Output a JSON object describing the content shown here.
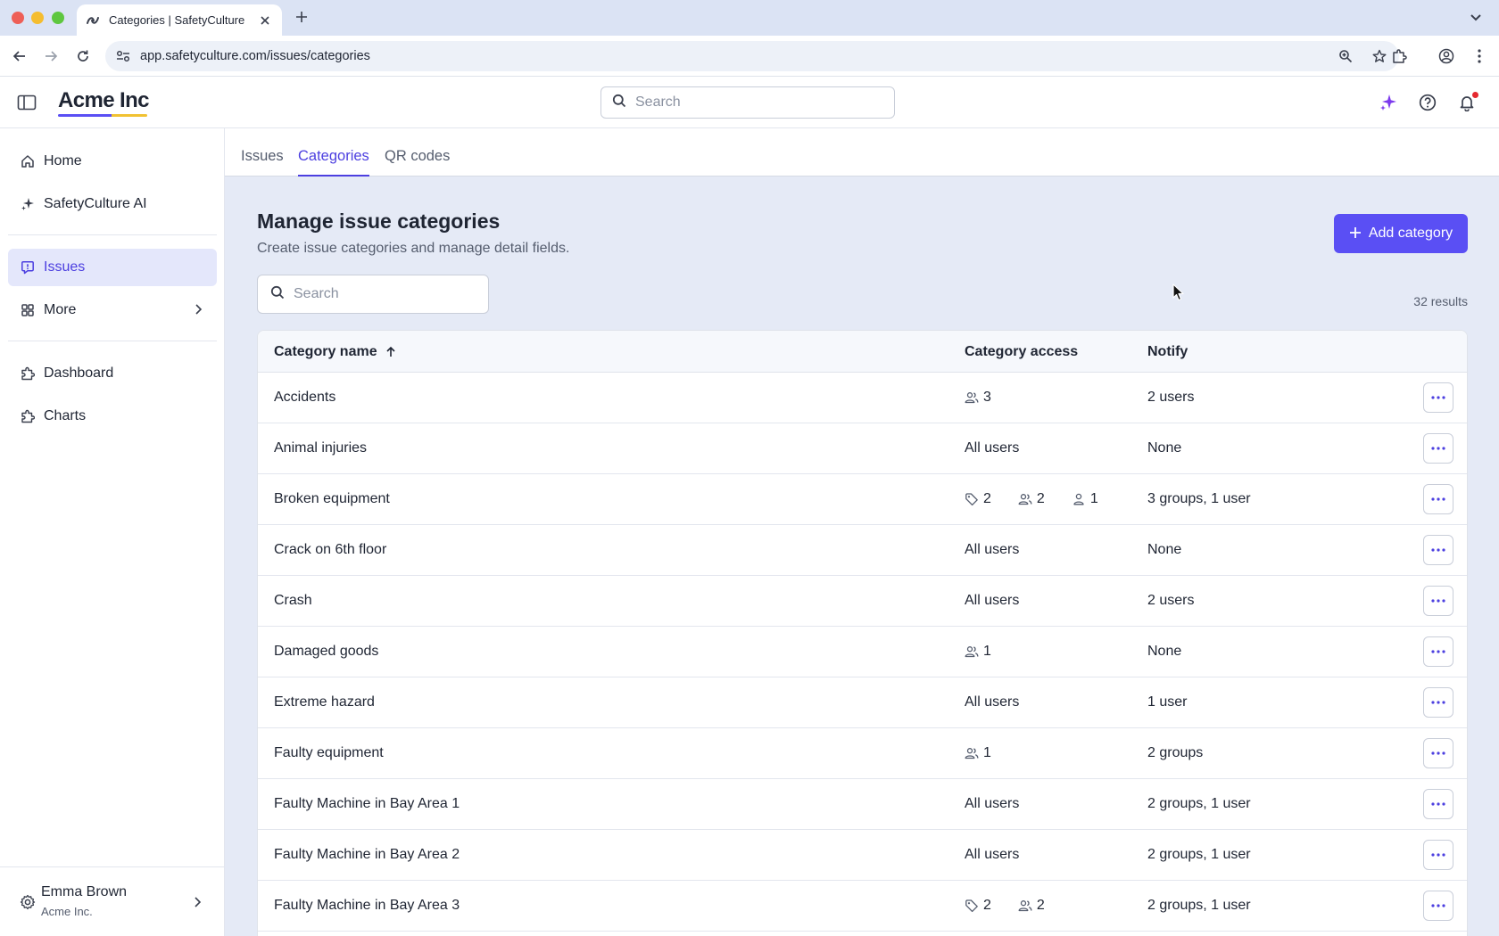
{
  "browser": {
    "tab_title": "Categories | SafetyCulture",
    "url": "app.safetyculture.com/issues/categories"
  },
  "header": {
    "brand": "Acme Inc",
    "search_placeholder": "Search"
  },
  "sidebar": {
    "items": [
      {
        "label": "Home",
        "icon": "home-icon"
      },
      {
        "label": "SafetyCulture AI",
        "icon": "sparkle-icon"
      },
      {
        "label": "Issues",
        "icon": "issue-icon",
        "active": true
      },
      {
        "label": "More",
        "icon": "grid-icon"
      },
      {
        "label": "Dashboard",
        "icon": "puzzle-icon"
      },
      {
        "label": "Charts",
        "icon": "puzzle-icon"
      }
    ],
    "user": {
      "name": "Emma Brown",
      "org": "Acme Inc."
    }
  },
  "tabs": [
    {
      "label": "Issues"
    },
    {
      "label": "Categories",
      "active": true
    },
    {
      "label": "QR codes"
    }
  ],
  "main": {
    "title": "Manage issue categories",
    "subtitle": "Create issue categories and manage detail fields.",
    "add_button": "Add category",
    "search_placeholder": "Search",
    "result_count": "32 results"
  },
  "table": {
    "columns": [
      "Category name",
      "Category access",
      "Notify"
    ],
    "rows": [
      {
        "name": "Accidents",
        "access_text": "",
        "access": [
          {
            "icon": "group-icon",
            "count": "3"
          }
        ],
        "notify": "2 users"
      },
      {
        "name": "Animal injuries",
        "access_text": "All users",
        "access": [],
        "notify": "None"
      },
      {
        "name": "Broken equipment",
        "access_text": "",
        "access": [
          {
            "icon": "tag-icon",
            "count": "2"
          },
          {
            "icon": "group-icon",
            "count": "2"
          },
          {
            "icon": "user-icon",
            "count": "1"
          }
        ],
        "notify": "3 groups, 1 user"
      },
      {
        "name": "Crack on 6th floor",
        "access_text": "All users",
        "access": [],
        "notify": "None"
      },
      {
        "name": "Crash",
        "access_text": "All users",
        "access": [],
        "notify": "2 users"
      },
      {
        "name": "Damaged goods",
        "access_text": "",
        "access": [
          {
            "icon": "group-icon",
            "count": "1"
          }
        ],
        "notify": "None"
      },
      {
        "name": "Extreme hazard",
        "access_text": "All users",
        "access": [],
        "notify": "1 user"
      },
      {
        "name": "Faulty equipment",
        "access_text": "",
        "access": [
          {
            "icon": "group-icon",
            "count": "1"
          }
        ],
        "notify": "2 groups"
      },
      {
        "name": "Faulty Machine in Bay Area 1",
        "access_text": "All users",
        "access": [],
        "notify": "2 groups, 1 user"
      },
      {
        "name": "Faulty Machine in Bay Area 2",
        "access_text": "All users",
        "access": [],
        "notify": "2 groups, 1 user"
      },
      {
        "name": "Faulty Machine in Bay Area 3",
        "access_text": "",
        "access": [
          {
            "icon": "tag-icon",
            "count": "2"
          },
          {
            "icon": "group-icon",
            "count": "2"
          }
        ],
        "notify": "2 groups, 1 user"
      }
    ]
  },
  "colors": {
    "accent": "#5a4ff4",
    "accent_text": "#4c3fe0",
    "main_bg": "#e5eaf6",
    "notification_dot": "#e5292f"
  }
}
